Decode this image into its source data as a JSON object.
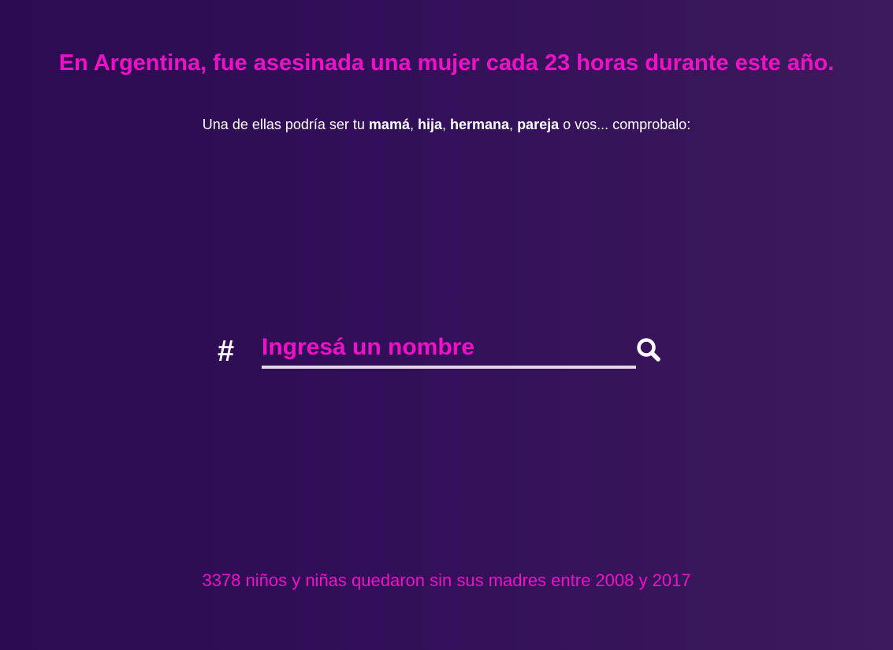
{
  "header": {
    "title": "En Argentina, fue asesinada una mujer cada 23 horas durante este año."
  },
  "intro": {
    "prefix": "Una de ellas podría ser tu ",
    "word_1": "mamá",
    "sep_1": ", ",
    "word_2": "hija",
    "sep_2": ", ",
    "word_3": "hermana",
    "sep_3": ", ",
    "word_4": "pareja",
    "suffix": " o vos... comprobalo:"
  },
  "search": {
    "hash_symbol": "#",
    "placeholder": "Ingresá un nombre",
    "value": "",
    "icon": "search-icon"
  },
  "footer": {
    "note": "3378 niños y niñas quedaron sin sus madres entre 2008 y 2017"
  },
  "colors": {
    "accent": "#f010c8",
    "background_start": "#2c0b52",
    "background_end": "#3d1a5b",
    "text": "#ffffff",
    "underline": "#e0d6e6"
  }
}
